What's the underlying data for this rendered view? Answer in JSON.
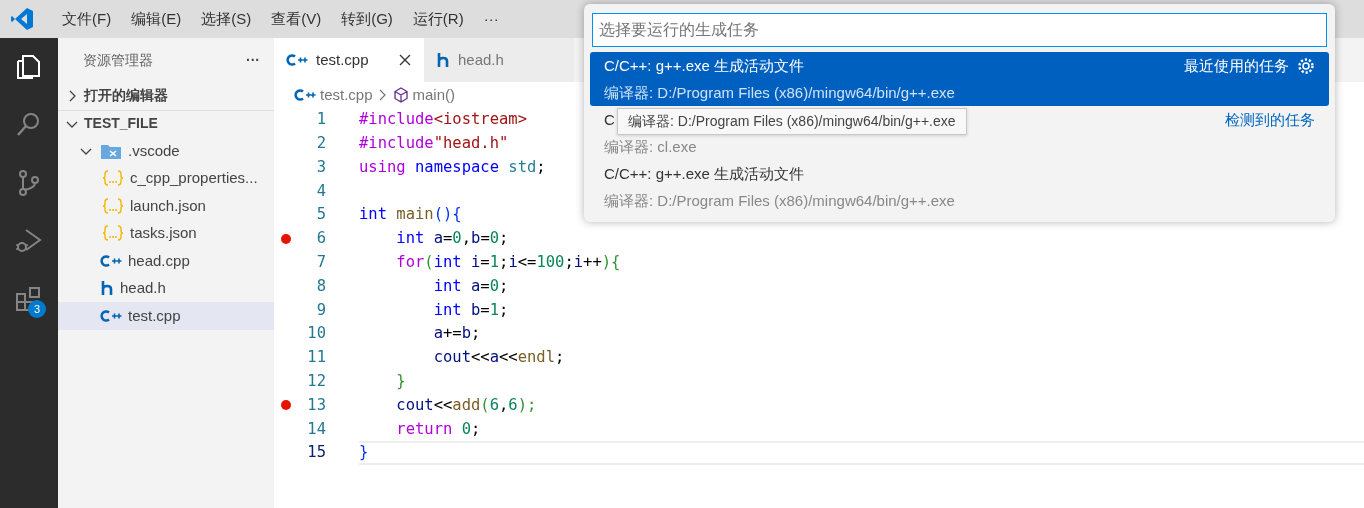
{
  "menu": [
    {
      "label": "文件(F)"
    },
    {
      "label": "编辑(E)"
    },
    {
      "label": "选择(S)"
    },
    {
      "label": "查看(V)"
    },
    {
      "label": "转到(G)"
    },
    {
      "label": "运行(R)"
    },
    {
      "label": "···"
    }
  ],
  "activity_bar": [
    {
      "kind": "explorer",
      "selected": true
    },
    {
      "kind": "search",
      "selected": false
    },
    {
      "kind": "scm",
      "selected": false
    },
    {
      "kind": "debug",
      "selected": false
    },
    {
      "kind": "extensions",
      "selected": false,
      "badge": "3"
    }
  ],
  "sidebar": {
    "title": "资源管理器",
    "more": "···",
    "sections": [
      {
        "label": "打开的编辑器",
        "expanded": false
      },
      {
        "label": "TEST_FILE",
        "expanded": true,
        "children": [
          {
            "label": ".vscode",
            "kind": "folder",
            "expanded": true,
            "selected": false,
            "children": [
              {
                "label": "c_cpp_properties...",
                "kind": "json",
                "selected": false
              },
              {
                "label": "launch.json",
                "kind": "json",
                "selected": false
              },
              {
                "label": "tasks.json",
                "kind": "json",
                "selected": false
              }
            ]
          },
          {
            "label": "head.cpp",
            "kind": "cpp",
            "selected": false
          },
          {
            "label": "head.h",
            "kind": "h",
            "selected": false
          },
          {
            "label": "test.cpp",
            "kind": "cpp",
            "selected": true
          }
        ]
      }
    ]
  },
  "tabs": [
    {
      "label": "test.cpp",
      "kind": "cpp",
      "selected": true
    },
    {
      "label": "head.h",
      "kind": "h",
      "selected": false
    }
  ],
  "breadcrumb": [
    {
      "label": "test.cpp",
      "kind": "cpp"
    },
    {
      "label": "main()",
      "kind": "symbol"
    }
  ],
  "code": [
    {
      "number": "1",
      "breakpoint": false,
      "current": false,
      "tokens": [
        {
          "text": "#include",
          "kind": "pre"
        },
        {
          "text": "<iostream>",
          "kind": "str"
        }
      ]
    },
    {
      "number": "2",
      "breakpoint": false,
      "current": false,
      "tokens": [
        {
          "text": "#include",
          "kind": "pre"
        },
        {
          "text": "\"head.h\"",
          "kind": "str"
        }
      ]
    },
    {
      "number": "3",
      "breakpoint": false,
      "current": false,
      "tokens": [
        {
          "text": "using",
          "kind": "ctrl"
        },
        {
          "text": " namespace",
          "kind": "type"
        },
        {
          "text": " std",
          "kind": "ns"
        },
        {
          "text": ";",
          "kind": "p"
        }
      ]
    },
    {
      "number": "4",
      "breakpoint": false,
      "current": false
    },
    {
      "number": "5",
      "breakpoint": false,
      "current": false,
      "tokens": [
        {
          "text": "int",
          "kind": "type"
        },
        {
          "text": " main",
          "kind": "fn"
        },
        {
          "text": "(){",
          "kind": "b1"
        }
      ]
    },
    {
      "number": "6",
      "breakpoint": true,
      "current": false,
      "tokens": [
        {
          "text": "    int",
          "kind": "type"
        },
        {
          "text": " a",
          "kind": "var"
        },
        {
          "text": "=",
          "kind": "p"
        },
        {
          "text": "0",
          "kind": "num"
        },
        {
          "text": ",",
          "kind": "p"
        },
        {
          "text": "b",
          "kind": "var"
        },
        {
          "text": "=",
          "kind": "p"
        },
        {
          "text": "0",
          "kind": "num"
        },
        {
          "text": ";",
          "kind": "p"
        }
      ]
    },
    {
      "number": "7",
      "breakpoint": false,
      "current": false,
      "tokens": [
        {
          "text": "    for",
          "kind": "ctrl"
        },
        {
          "text": "(",
          "kind": "b2"
        },
        {
          "text": "int",
          "kind": "type"
        },
        {
          "text": " i",
          "kind": "var"
        },
        {
          "text": "=",
          "kind": "p"
        },
        {
          "text": "1",
          "kind": "num"
        },
        {
          "text": ";",
          "kind": "p"
        },
        {
          "text": "i",
          "kind": "var"
        },
        {
          "text": "<=",
          "kind": "p"
        },
        {
          "text": "100",
          "kind": "num"
        },
        {
          "text": ";",
          "kind": "p"
        },
        {
          "text": "i",
          "kind": "var"
        },
        {
          "text": "++",
          "kind": "p"
        },
        {
          "text": "){",
          "kind": "b2"
        }
      ]
    },
    {
      "number": "8",
      "breakpoint": false,
      "current": false,
      "tokens": [
        {
          "text": "        int",
          "kind": "type"
        },
        {
          "text": " a",
          "kind": "var"
        },
        {
          "text": "=",
          "kind": "p"
        },
        {
          "text": "0",
          "kind": "num"
        },
        {
          "text": ";",
          "kind": "p"
        }
      ]
    },
    {
      "number": "9",
      "breakpoint": false,
      "current": false,
      "tokens": [
        {
          "text": "        int",
          "kind": "type"
        },
        {
          "text": " b",
          "kind": "var"
        },
        {
          "text": "=",
          "kind": "p"
        },
        {
          "text": "1",
          "kind": "num"
        },
        {
          "text": ";",
          "kind": "p"
        }
      ]
    },
    {
      "number": "10",
      "breakpoint": false,
      "current": false,
      "tokens": [
        {
          "text": "        a",
          "kind": "var"
        },
        {
          "text": "+=",
          "kind": "p"
        },
        {
          "text": "b",
          "kind": "var"
        },
        {
          "text": ";",
          "kind": "p"
        }
      ]
    },
    {
      "number": "11",
      "breakpoint": false,
      "current": false,
      "tokens": [
        {
          "text": "        cout",
          "kind": "var"
        },
        {
          "text": "<<",
          "kind": "p"
        },
        {
          "text": "a",
          "kind": "var"
        },
        {
          "text": "<<",
          "kind": "p"
        },
        {
          "text": "endl",
          "kind": "fn"
        },
        {
          "text": ";",
          "kind": "p"
        }
      ]
    },
    {
      "number": "12",
      "breakpoint": false,
      "current": false,
      "tokens": [
        {
          "text": "    }",
          "kind": "b2"
        }
      ]
    },
    {
      "number": "13",
      "breakpoint": true,
      "current": false,
      "tokens": [
        {
          "text": "    cout",
          "kind": "var"
        },
        {
          "text": "<<",
          "kind": "p"
        },
        {
          "text": "add",
          "kind": "fn"
        },
        {
          "text": "(",
          "kind": "b2"
        },
        {
          "text": "6",
          "kind": "num"
        },
        {
          "text": ",",
          "kind": "p"
        },
        {
          "text": "6",
          "kind": "num"
        },
        {
          "text": ");",
          "kind": "b2"
        }
      ]
    },
    {
      "number": "14",
      "breakpoint": false,
      "current": false,
      "tokens": [
        {
          "text": "    return",
          "kind": "ctrl"
        },
        {
          "text": " 0",
          "kind": "num"
        },
        {
          "text": ";",
          "kind": "p"
        }
      ]
    },
    {
      "number": "15",
      "breakpoint": false,
      "current": true,
      "tokens": [
        {
          "text": "}",
          "kind": "b1"
        }
      ]
    }
  ],
  "quick_pick": {
    "placeholder": "选择要运行的生成任务",
    "items": [
      {
        "label": "C/C++: g++.exe 生成活动文件",
        "detail": "编译器: D:/Program Files (x86)/mingw64/bin/g++.exe",
        "group": "最近使用的任务",
        "selected": true
      },
      {
        "label": "C",
        "detail": "编译器: cl.exe",
        "group": "检测到的任务",
        "selected": false
      },
      {
        "label": "C/C++: g++.exe 生成活动文件",
        "detail": "编译器: D:/Program Files (x86)/mingw64/bin/g++.exe",
        "selected": false
      }
    ],
    "tooltip": "编译器: D:/Program Files (x86)/mingw64/bin/g++.exe"
  }
}
